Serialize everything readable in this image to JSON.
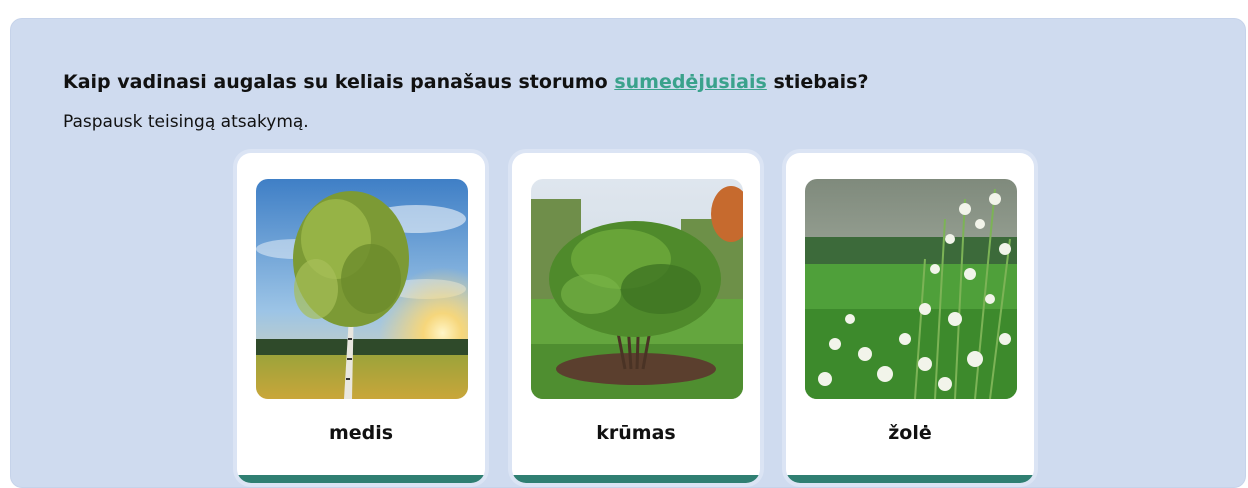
{
  "question": {
    "before": "Kaip vadinasi augalas su keliais panašaus storumo ",
    "term": "sumedėjusiais",
    "after": " stiebais?"
  },
  "instruction": "Paspausk teisingą atsakymą.",
  "answers": [
    {
      "label": "medis",
      "image": "birch-tree-image"
    },
    {
      "label": "krūmas",
      "image": "round-bush-image"
    },
    {
      "label": "žolė",
      "image": "wild-grass-flowers-image"
    }
  ],
  "colors": {
    "panel_bg": "#cfdbef",
    "term_link": "#3aa28c",
    "card_stripe": "#2f7f72"
  }
}
